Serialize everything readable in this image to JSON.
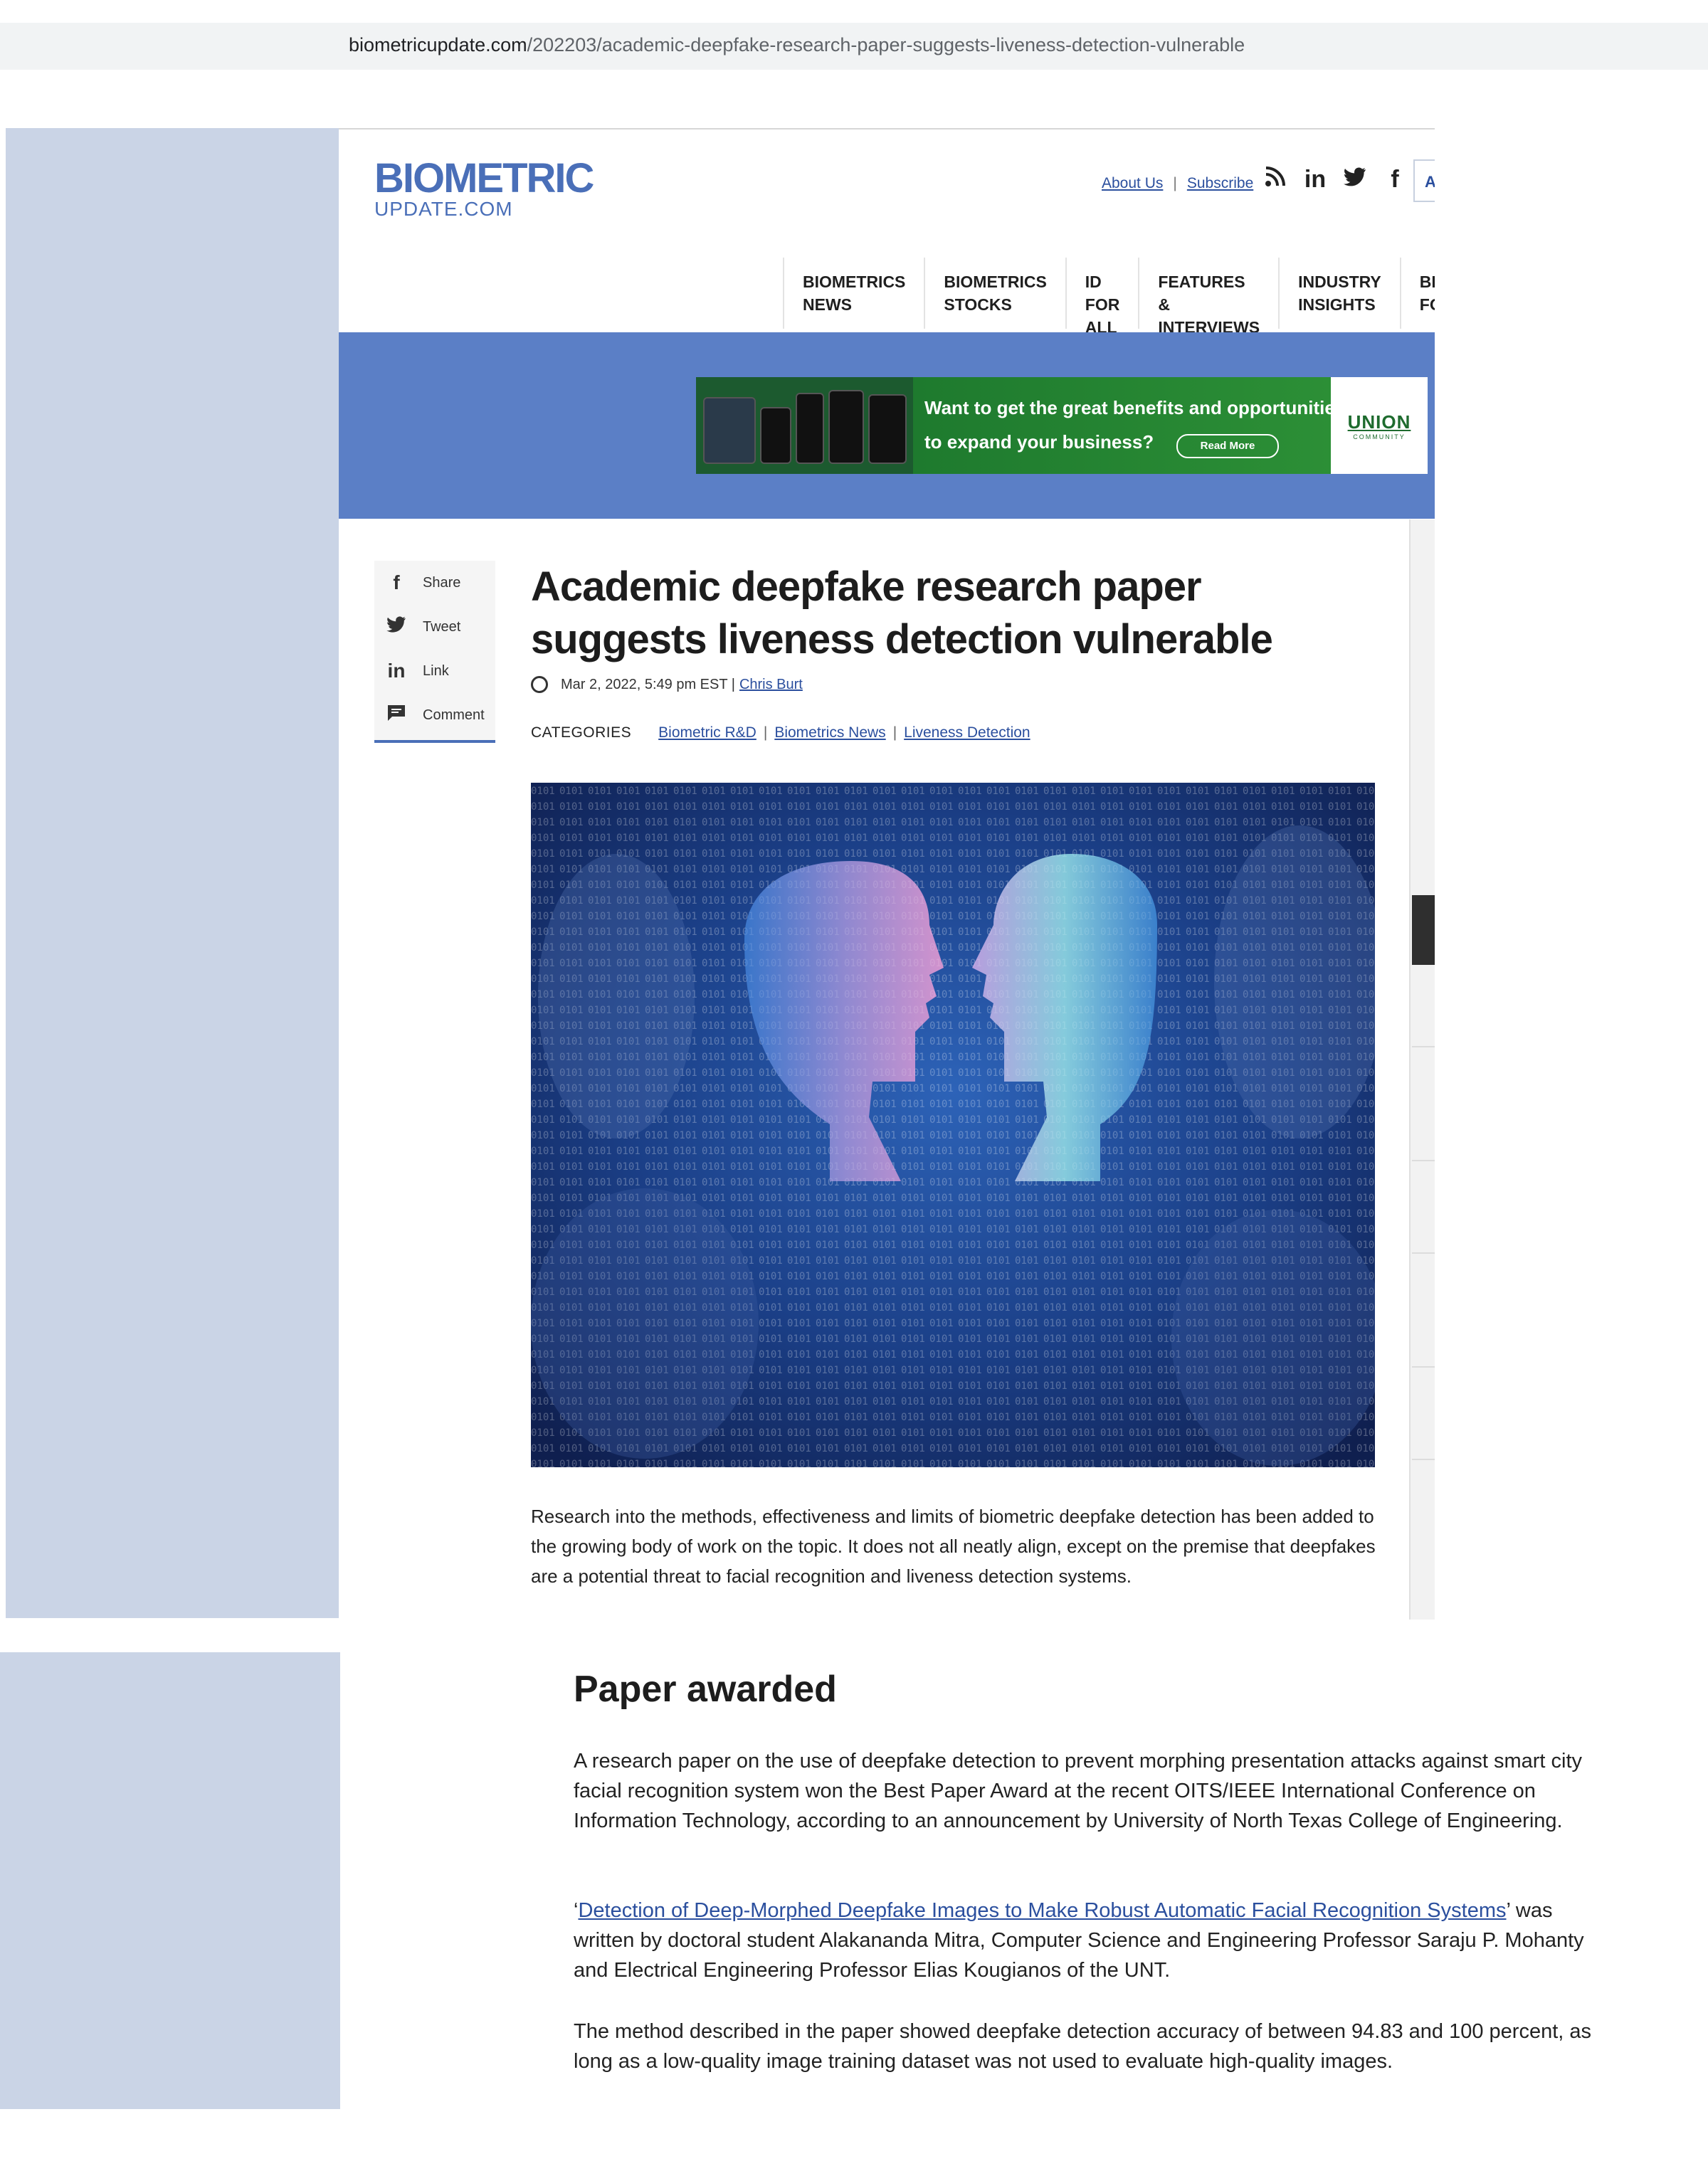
{
  "browser": {
    "url_host": "biometricupdate.com",
    "url_path": "/202203/academic-deepfake-research-paper-suggests-liveness-detection-vulnerable"
  },
  "header": {
    "logo_line1": "BIOMETRIC",
    "logo_line2": "UPDATE.COM",
    "links": [
      "About Us",
      "Subscribe"
    ],
    "search_partial": "A",
    "social_icons": [
      "rss-icon",
      "linkedin-icon",
      "twitter-icon",
      "facebook-icon"
    ]
  },
  "nav": {
    "items": [
      "BIOMETRICS\nNEWS",
      "BIOMETRICS\nSTOCKS",
      "ID FOR\nALL",
      "FEATURES &\nINTERVIEWS",
      "INDUSTRY\nINSIGHTS",
      "BRAND\nFOCUS"
    ]
  },
  "ad": {
    "line1": "Want to get the great benefits and opportunities",
    "line2": "to expand your business?",
    "button": "Read More",
    "brand": "UNION",
    "brand_sub": "COMMUNITY"
  },
  "share": {
    "items": [
      {
        "icon": "facebook-icon",
        "label": "Share"
      },
      {
        "icon": "twitter-icon",
        "label": "Tweet"
      },
      {
        "icon": "linkedin-icon",
        "label": "Link"
      },
      {
        "icon": "comment-icon",
        "label": "Comment"
      }
    ]
  },
  "article": {
    "title": "Academic deepfake research paper suggests liveness detection vulnerable",
    "date": "Mar 2, 2022, 5:49 pm EST |",
    "author": "Chris Burt",
    "categories_label": "CATEGORIES",
    "categories": [
      "Biometric R&D",
      "Biometrics News",
      "Liveness Detection"
    ],
    "caption": "Research into the methods, effectiveness and limits of biometric deepfake detection has been added to the growing body of work on the topic. It does not all neatly align, except on the premise that deepfakes are a potential threat to facial recognition and liveness detection systems."
  },
  "lower": {
    "heading": "Paper awarded",
    "p1": "A research paper on the use of deepfake detection to prevent morphing presentation attacks against smart city facial recognition system won the Best Paper Award at the recent OITS/IEEE International Conference on Information Technology, according to an announcement by University of North Texas College of Engineering.",
    "p2_open_quote": "‘",
    "p2_link": "Detection of Deep-Morphed Deepfake Images to Make Robust Automatic Facial Recognition Systems",
    "p2_rest": "’ was written by doctoral student Alakananda Mitra, Computer Science and Engineering Professor Saraju P. Mohanty and Electrical Engineering Professor Elias Kougianos of the UNT.",
    "p3": "The method described in the paper showed deepfake detection accuracy of between 94.83 and 100 percent, as long as a low-quality image training dataset was not used to evaluate high-quality images."
  },
  "colors": {
    "brand_blue": "#4a6fb8",
    "band_blue": "#5b7fc6",
    "side_panel": "#cad4e6",
    "link": "#2b4f9e",
    "ad_green": "#1e7a2e"
  }
}
